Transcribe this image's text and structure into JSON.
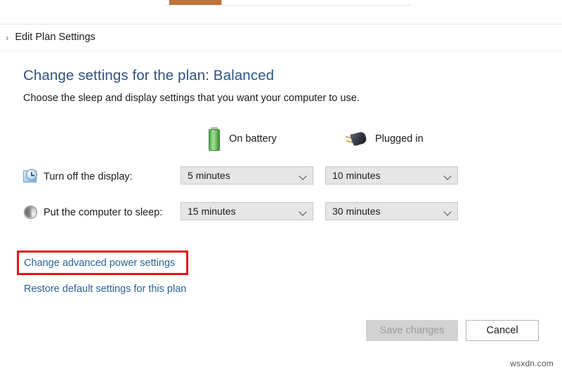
{
  "window": {
    "top_fragment_color": "#c1713a"
  },
  "breadcrumb": {
    "chevron": "›",
    "label": "Edit Plan Settings"
  },
  "main": {
    "title": "Change settings for the plan: Balanced",
    "subtitle": "Choose the sleep and display settings that you want your computer to use."
  },
  "columns": [
    {
      "icon": "battery-icon",
      "label": "On battery"
    },
    {
      "icon": "plug-icon",
      "label": "Plugged in"
    }
  ],
  "settings": [
    {
      "icon": "display-clock-icon",
      "label": "Turn off the display:",
      "on_battery": "5 minutes",
      "plugged_in": "10 minutes"
    },
    {
      "icon": "sleep-moon-icon",
      "label": "Put the computer to sleep:",
      "on_battery": "15 minutes",
      "plugged_in": "30 minutes"
    }
  ],
  "links": {
    "advanced": "Change advanced power settings",
    "restore": "Restore default settings for this plan"
  },
  "annotation": {
    "color": "#e8131a",
    "target": "Change advanced power settings"
  },
  "buttons": {
    "save": "Save changes",
    "save_enabled": false,
    "cancel": "Cancel",
    "cancel_enabled": true
  },
  "watermark": "wsxdn.com"
}
